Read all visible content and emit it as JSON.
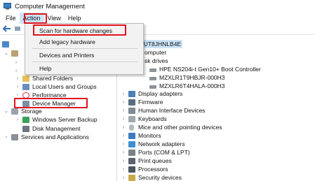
{
  "window": {
    "title": "Computer Management"
  },
  "menubar": {
    "items": [
      "File",
      "Action",
      "View",
      "Help"
    ]
  },
  "action_menu": {
    "items": [
      "Scan for hardware changes",
      "Add legacy hardware",
      "Devices and Printers",
      "Help"
    ]
  },
  "left_tree": {
    "items": [
      "Shared Folders",
      "Local Users and Groups",
      "Performance",
      "Device Manager",
      "Storage",
      "Windows Server Backup",
      "Disk Management",
      "Services and Applications"
    ]
  },
  "device_tree": {
    "computer_name": "5UT8JHNLB4E",
    "computer": "omputer",
    "disk_drives": "sk drives",
    "disks": [
      "HPE NS204i-t Gen10+ Boot Controller",
      "MZXLR1T9HBJR-000H3",
      "MZXLR6T4HALA-000H3"
    ],
    "categories": [
      "Display adapters",
      "Firmware",
      "Human Interface Devices",
      "Keyboards",
      "Mice and other pointing devices",
      "Monitors",
      "Network adapters",
      "Ports (COM & LPT)",
      "Print queues",
      "Processors",
      "Security devices"
    ]
  },
  "highlight_color": "#e0141e",
  "menu_active_color": "#cce4f7"
}
